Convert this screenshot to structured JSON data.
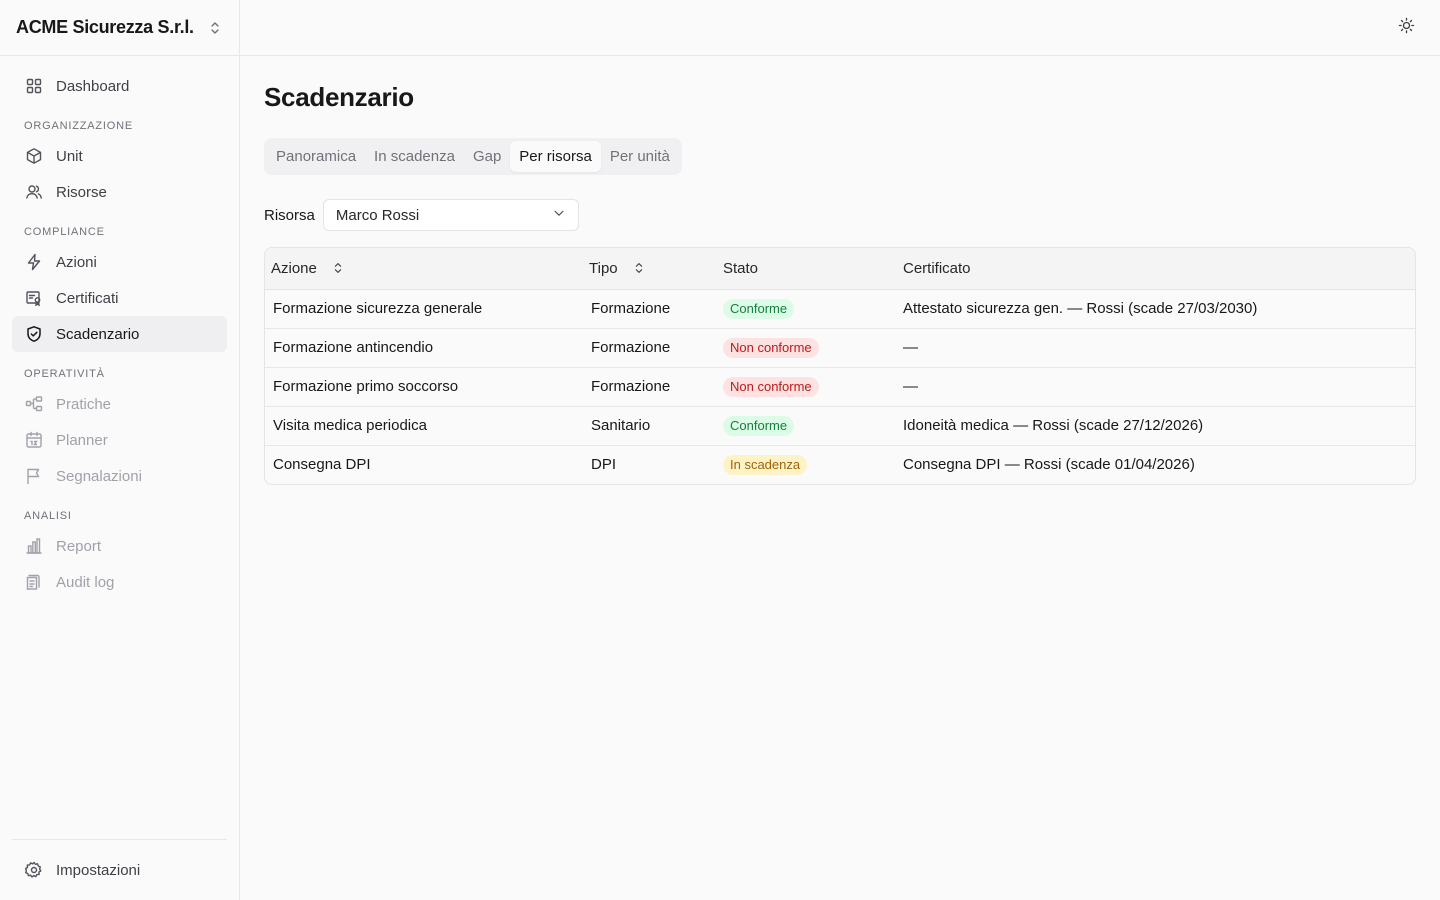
{
  "org": {
    "name": "ACME Sicurezza S.r.l."
  },
  "sidebar": {
    "dashboard": "Dashboard",
    "sections": {
      "organizzazione": "ORGANIZZAZIONE",
      "compliance": "COMPLIANCE",
      "operativita": "OPERATIVITÀ",
      "analisi": "ANALISI"
    },
    "items": {
      "unit": "Unit",
      "risorse": "Risorse",
      "azioni": "Azioni",
      "certificati": "Certificati",
      "scadenzario": "Scadenzario",
      "pratiche": "Pratiche",
      "planner": "Planner",
      "segnalazioni": "Segnalazioni",
      "report": "Report",
      "audit_log": "Audit log"
    },
    "footer": {
      "impostazioni": "Impostazioni"
    }
  },
  "page": {
    "title": "Scadenzario"
  },
  "tabs": [
    "Panoramica",
    "In scadenza",
    "Gap",
    "Per risorsa",
    "Per unità"
  ],
  "active_tab": "Per risorsa",
  "filter": {
    "label": "Risorsa",
    "value": "Marco Rossi"
  },
  "table": {
    "headers": {
      "azione": "Azione",
      "tipo": "Tipo",
      "stato": "Stato",
      "certificato": "Certificato"
    },
    "rows": [
      {
        "azione": "Formazione sicurezza generale",
        "tipo": "Formazione",
        "stato": "Conforme",
        "stato_kind": "ok",
        "certificato": "Attestato sicurezza gen. — Rossi (scade 27/03/2030)"
      },
      {
        "azione": "Formazione antincendio",
        "tipo": "Formazione",
        "stato": "Non conforme",
        "stato_kind": "ko",
        "certificato": "—"
      },
      {
        "azione": "Formazione primo soccorso",
        "tipo": "Formazione",
        "stato": "Non conforme",
        "stato_kind": "ko",
        "certificato": "—"
      },
      {
        "azione": "Visita medica periodica",
        "tipo": "Sanitario",
        "stato": "Conforme",
        "stato_kind": "ok",
        "certificato": "Idoneità medica — Rossi (scade 27/12/2026)"
      },
      {
        "azione": "Consegna DPI",
        "tipo": "DPI",
        "stato": "In scadenza",
        "stato_kind": "warn",
        "certificato": "Consegna DPI — Rossi (scade 01/04/2026)"
      }
    ]
  },
  "colors": {
    "ok_bg": "#dcfce7",
    "ok_fg": "#15803d",
    "ko_bg": "#fee2e2",
    "ko_fg": "#b91c1c",
    "warn_bg": "#fef3c7",
    "warn_fg": "#a16207"
  }
}
